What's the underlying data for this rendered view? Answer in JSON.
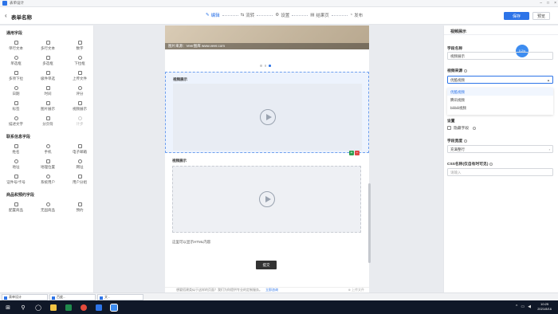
{
  "window": {
    "app_title": "表单设计"
  },
  "header": {
    "back_icon": "‹",
    "form_title": "表单名称",
    "steps": [
      {
        "icon": "✎",
        "label": "编辑",
        "active": true
      },
      {
        "icon": "⇆",
        "label": "流转",
        "active": false
      },
      {
        "icon": "⚙",
        "label": "设置",
        "active": false
      },
      {
        "icon": "▤",
        "label": "结果页",
        "active": false
      },
      {
        "icon": "◔",
        "label": "发布",
        "active": false
      }
    ],
    "save_label": "保存",
    "cancel_label": "预览"
  },
  "left_panel": {
    "sections": [
      {
        "title": "通用字段",
        "items": [
          {
            "label": "单行文本",
            "icon": "text-line-icon"
          },
          {
            "label": "多行文本",
            "icon": "text-area-icon"
          },
          {
            "label": "数字",
            "icon": "number-icon"
          },
          {
            "label": "单选框",
            "icon": "radio-icon"
          },
          {
            "label": "多选框",
            "icon": "checkbox-icon"
          },
          {
            "label": "下拉框",
            "icon": "dropdown-icon"
          },
          {
            "label": "多项下拉",
            "icon": "multi-dropdown-icon"
          },
          {
            "label": "级件单选",
            "icon": "cascade-icon"
          },
          {
            "label": "上传文件",
            "icon": "upload-icon"
          },
          {
            "label": "日期",
            "icon": "date-icon"
          },
          {
            "label": "时间",
            "icon": "time-icon"
          },
          {
            "label": "评分",
            "icon": "rating-icon"
          },
          {
            "label": "标签",
            "icon": "tag-icon"
          },
          {
            "label": "图片展示",
            "icon": "image-icon"
          },
          {
            "label": "视频展示",
            "icon": "video-icon"
          },
          {
            "label": "描述文字",
            "icon": "description-icon"
          },
          {
            "label": "分页符",
            "icon": "page-break-icon"
          },
          {
            "label": "计步",
            "icon": "step-icon",
            "disabled": true
          }
        ]
      },
      {
        "title": "联系信息字段",
        "items": [
          {
            "label": "姓名",
            "icon": "person-icon"
          },
          {
            "label": "手机",
            "icon": "phone-icon"
          },
          {
            "label": "电子邮箱",
            "icon": "email-icon"
          },
          {
            "label": "地址",
            "icon": "address-icon"
          },
          {
            "label": "地理位置",
            "icon": "location-icon"
          },
          {
            "label": "网址",
            "icon": "link-icon"
          },
          {
            "label": "证件号/卡号",
            "icon": "id-card-icon"
          },
          {
            "label": "系统用户",
            "icon": "system-user-icon"
          },
          {
            "label": "用户分组",
            "icon": "user-group-icon"
          }
        ]
      },
      {
        "title": "商品和预约字段",
        "items": [
          {
            "label": "配置商品",
            "icon": "product-icon"
          },
          {
            "label": "无固商品",
            "icon": "free-product-icon"
          },
          {
            "label": "预约",
            "icon": "booking-icon"
          }
        ]
      }
    ]
  },
  "canvas": {
    "banner_caption": "图片来源：Veer图库 www.veer.com",
    "carousel_page": 3,
    "carousel_total": 3,
    "video_block_1": {
      "title": "视频展示"
    },
    "video_block_2": {
      "title": "视频展示",
      "html_note": "这里可以显示HTML内容"
    },
    "submit_label": "提交",
    "footer_text": "想要搭建类似于这样的页面？我们为你提供专业的定制服务。",
    "footer_link": "立即咨询",
    "footer_right": "⊕ 上传文件"
  },
  "right_panel": {
    "title": "视频展示",
    "field_name_label": "字段名称",
    "field_name_value": "视频展示",
    "video_source_label": "视频来源",
    "video_source_value": "优酷视频",
    "video_source_options": [
      "优酷视频",
      "腾讯视频",
      "bilibili视频"
    ],
    "settings_label": "设置",
    "hide_field_label": "隐藏字段",
    "field_width_label": "字段宽度",
    "field_width_value": "充满整行",
    "css_label": "CSS名称(仅自有时可见)",
    "css_placeholder": "请输入",
    "bubble_text": "0.2/s"
  },
  "taskbar": {
    "minimized_windows": [
      "表单设计",
      "百度...",
      "文..."
    ],
    "time": "10:25",
    "date": "2021/8/16"
  },
  "colors": {
    "accent": "#2d74e8",
    "add": "#2e9e4f",
    "delete": "#e04848"
  }
}
